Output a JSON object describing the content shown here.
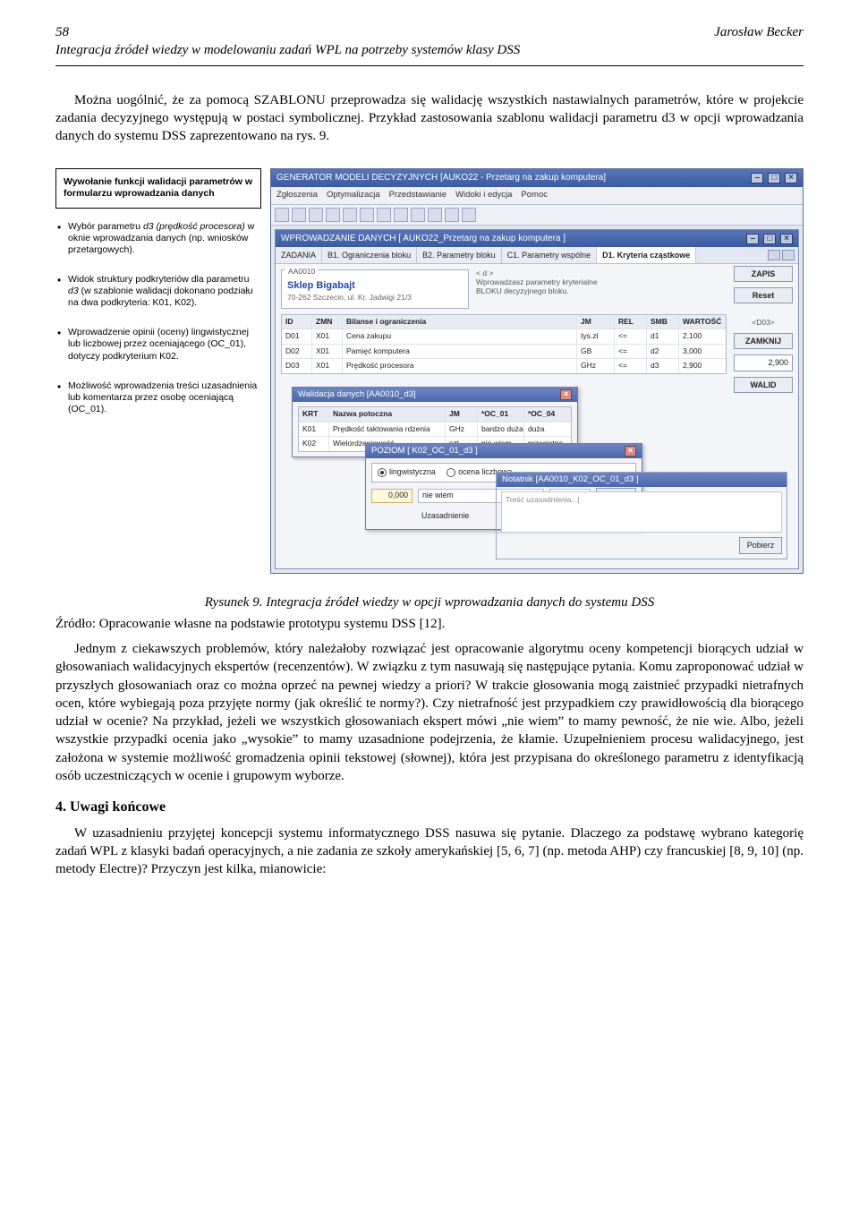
{
  "page_number": "58",
  "author": "Jarosław Becker",
  "running_subtitle": "Integracja źródeł wiedzy w modelowaniu zadań WPL na potrzeby systemów klasy DSS",
  "para1": "Można uogólnić, że za pomocą SZABLONU przeprowadza się walidację wszystkich nastawialnych parametrów, które w projekcie zadania decyzyjnego występują w postaci symbolicznej. Przykład zastosowania szablonu walidacji parametru d3 w opcji wprowadzania danych do systemu DSS zaprezentowano na rys. 9.",
  "callouts": {
    "box": "Wywołanie funkcji walidacji parametrów w formularzu wprowadzania danych",
    "items": [
      "Wybór parametru <em>d3 (prędkość procesora)</em> w oknie wprowadzania danych (np. wniosków przetargowych).",
      "Widok struktury podkryteriów dla parametru <em>d3</em> (w szablonie walidacji dokonano podziału na dwa podkryteria: K01, K02).",
      "Wprowadzenie opinii (oceny) lingwistycznej lub liczbowej przez oceniającego (OC_01), dotyczy podkryterium K02.",
      "Możliwość wprowadzenia treści uzasadnienia lub komentarza przez osobę oceniającą (OC_01)."
    ]
  },
  "app": {
    "title": "GENERATOR MODELI DECYZYJNYCH  [AUKO22 - Przetarg na zakup komputera]",
    "menu": [
      "Zgłoszenia",
      "Optymalizacja",
      "Przedstawianie",
      "Widoki i edycja",
      "Pomoc"
    ],
    "subwin_title": "WPROWADZANIE DANYCH [ AUKO22_Przetarg na zakup komputera ]",
    "tabs": [
      "ZADANIA",
      "B1. Ograniczenia bloku",
      "B2. Parametry bloku",
      "C1. Parametry wspólne",
      "D1. Kryteria cząstkowe"
    ],
    "legend_a": "AA0010",
    "shop": "Sklep Bigabajt",
    "shop_addr": "70-262  Szczecin, ul. Kr. Jadwigi 21/3",
    "hint_bracket": "< d >",
    "hint_text": "Wprowadzasz parametry kryterialne BLOKU decyzyjnego bloku.",
    "btn_zapis": "ZAPIS",
    "btn_reset": "Reset",
    "btn_zamknij": "ZAMKNIJ",
    "btn_walid": "WALID",
    "d03_label": "<D03>",
    "d03_val": "2,900",
    "table_head": [
      "ID",
      "ZMN",
      "Bilanse i ograniczenia",
      "JM",
      "REL",
      "SMB",
      "WARTOŚĆ"
    ],
    "table_rows": [
      [
        "D01",
        "X01",
        "Cena zakupu",
        "tys.zł",
        "<=",
        "d1",
        "2,100"
      ],
      [
        "D02",
        "X01",
        "Pamięć komputera",
        "GB",
        "<=",
        "d2",
        "3,000"
      ],
      [
        "D03",
        "X01",
        "Prędkość procesora",
        "GHz",
        "<=",
        "d3",
        "2,900"
      ]
    ],
    "dlg1": {
      "title": "Walidacja danych [AA0010_d3]",
      "head": [
        "KRT",
        "Nazwa potoczna",
        "JM",
        "*OC_01",
        "*OC_04"
      ],
      "rows": [
        [
          "K01",
          "Prędkość taktowania rdzenia",
          "GHz",
          "bardzo duża",
          "duża"
        ],
        [
          "K02",
          "Wielordzeniowość",
          "szt.",
          "nie wiem",
          "przeciętna"
        ]
      ]
    },
    "dlg2": {
      "title": "POZIOM [ K02_OC_01_d3 ]",
      "radio_ling": "lingwistyczna",
      "radio_num": "ocena liczbowa",
      "val": "0,000",
      "label_niewiem": "nie wiem",
      "label_uzasad": "Uzasadnienie",
      "out": "0,000",
      "btn": "Pobierz",
      "btn2": "→"
    },
    "notatnik": {
      "title": "Notatnik [AA0010_K02_OC_01_d3 ]",
      "placeholder": "Treść uzasadnienia...|",
      "btn": "Pobierz"
    }
  },
  "caption": "Rysunek 9. Integracja źródeł wiedzy w opcji wprowadzania danych do systemu DSS",
  "source_line": "Źródło: Opracowanie własne na podstawie prototypu systemu DSS [12].",
  "para2": "Jednym z ciekawszych problemów, który należałoby rozwiązać jest opracowanie algorytmu oceny kompetencji biorących udział w głosowaniach walidacyjnych ekspertów (recenzentów). W związku z tym nasuwają się następujące pytania. Komu zaproponować udział w przyszłych głosowaniach oraz co można oprzeć na pewnej wiedzy a priori? W trakcie głosowania mogą zaistnieć przypadki nietrafnych ocen, które wybiegają poza przyjęte normy (jak określić te normy?). Czy nietrafność jest przypadkiem czy prawidłowością dla biorącego udział w ocenie? Na przykład, jeżeli we wszystkich głosowaniach ekspert mówi „nie wiem” to mamy pewność, że nie wie. Albo, jeżeli wszystkie przypadki ocenia jako „wysokie” to mamy uzasadnione podejrzenia, że kłamie. Uzupełnieniem procesu walidacyjnego, jest założona w systemie możliwość gromadzenia opinii tekstowej (słownej), która jest przypisana do określonego parametru z identyfikacją osób uczestniczących w ocenie i grupowym wyborze.",
  "section4": "4. Uwagi końcowe",
  "para3": "W uzasadnieniu przyjętej koncepcji systemu informatycznego DSS nasuwa się pytanie. Dlaczego za podstawę wybrano kategorię zadań WPL z klasyki badań operacyjnych, a nie zadania ze szkoły amerykańskiej [5, 6, 7] (np. metoda AHP) czy francuskiej [8, 9, 10] (np. metody Electre)? Przyczyn jest kilka, mianowicie:"
}
